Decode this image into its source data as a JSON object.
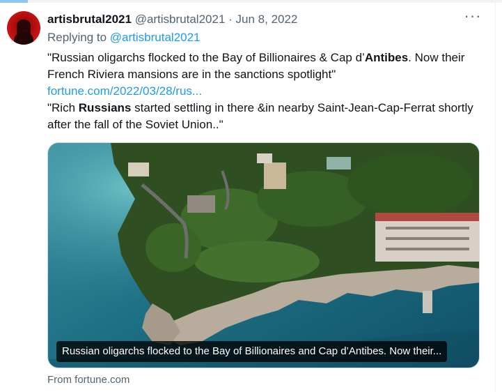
{
  "tweet": {
    "display_name": "artisbrutal2021",
    "handle": "@artisbrutal2021",
    "separator": "·",
    "date": "Jun 8, 2022",
    "more_icon": "more-horizontal-icon",
    "replying_prefix": "Replying to",
    "replying_handle": "@artisbrutal2021",
    "quote1_part1": "\"Russian oligarchs flocked to the Bay of Billionaires & Cap d’",
    "quote1_bold": "Antibes",
    "quote1_part2": ". Now their French Riviera mansions are in the sanctions spotlight\"",
    "link": "fortune.com/2022/03/28/rus...",
    "quote2_part1": "\"Rich ",
    "quote2_bold": "Russians",
    "quote2_part2": " started settling in there &in nearby Saint-Jean-Cap-Ferrat shortly after the fall of the Soviet Union..\""
  },
  "card": {
    "caption": "Russian oligarchs flocked to the Bay of Billionaires and Cap d’Antibes. Now their...",
    "source": "From fortune.com"
  },
  "colors": {
    "link": "#1d9bf0",
    "secondary_text": "#536471",
    "primary_text": "#0f1419"
  }
}
